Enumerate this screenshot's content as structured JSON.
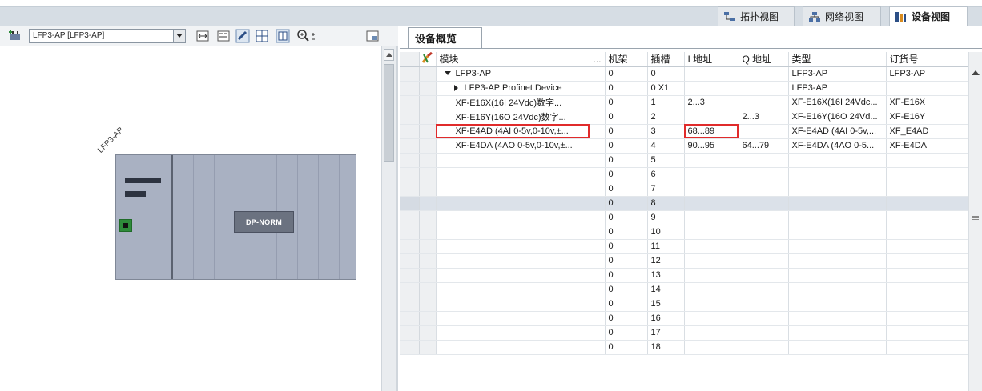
{
  "view_tabs": [
    {
      "label": "拓扑视图",
      "icon": "topology-view-icon",
      "active": false
    },
    {
      "label": "网络视图",
      "icon": "network-view-icon",
      "active": false
    },
    {
      "label": "设备视图",
      "icon": "device-view-icon",
      "active": true
    }
  ],
  "device_selector": {
    "value": "LFP3-AP [LFP3-AP]"
  },
  "canvas": {
    "rack_label": "LFP3-AP",
    "module_label": "DP-NORM"
  },
  "overview": {
    "tab_label": "设备概览",
    "columns": {
      "module": "模块",
      "more": "...",
      "rack": "机架",
      "slot": "插槽",
      "i_addr": "I 地址",
      "q_addr": "Q 地址",
      "type": "类型",
      "order": "订货号"
    },
    "rows": [
      {
        "module": "LFP3-AP",
        "rack": "0",
        "slot": "0",
        "i_addr": "",
        "q_addr": "",
        "type": "LFP3-AP",
        "order": "LFP3-AP",
        "indent": "expanded"
      },
      {
        "module": "LFP3-AP Profinet Device",
        "rack": "0",
        "slot": "0 X1",
        "i_addr": "",
        "q_addr": "",
        "type": "LFP3-AP",
        "order": "",
        "indent": "collapsed"
      },
      {
        "module": "XF-E16X(16I 24Vdc)数字...",
        "rack": "0",
        "slot": "1",
        "i_addr": "2...3",
        "q_addr": "",
        "type": "XF-E16X(16I 24Vdc...",
        "order": "XF-E16X",
        "indent": "leaf"
      },
      {
        "module": "XF-E16Y(16O 24Vdc)数字...",
        "rack": "0",
        "slot": "2",
        "i_addr": "",
        "q_addr": "2...3",
        "type": "XF-E16Y(16O 24Vd...",
        "order": "XF-E16Y",
        "indent": "leaf"
      },
      {
        "module": "XF-E4AD (4AI 0-5v,0-10v,±...",
        "rack": "0",
        "slot": "3",
        "i_addr": "68...89",
        "q_addr": "",
        "type": "XF-E4AD (4AI 0-5v,...",
        "order": "XF_E4AD",
        "indent": "leaf",
        "highlight": true
      },
      {
        "module": "XF-E4DA (4AO 0-5v,0-10v,±...",
        "rack": "0",
        "slot": "4",
        "i_addr": "90...95",
        "q_addr": "64...79",
        "type": "XF-E4DA (4AO 0-5...",
        "order": "XF-E4DA",
        "indent": "leaf"
      },
      {
        "module": "",
        "rack": "0",
        "slot": "5",
        "i_addr": "",
        "q_addr": "",
        "type": "",
        "order": "",
        "indent": "leaf"
      },
      {
        "module": "",
        "rack": "0",
        "slot": "6",
        "i_addr": "",
        "q_addr": "",
        "type": "",
        "order": "",
        "indent": "leaf"
      },
      {
        "module": "",
        "rack": "0",
        "slot": "7",
        "i_addr": "",
        "q_addr": "",
        "type": "",
        "order": "",
        "indent": "leaf"
      },
      {
        "module": "",
        "rack": "0",
        "slot": "8",
        "i_addr": "",
        "q_addr": "",
        "type": "",
        "order": "",
        "indent": "leaf",
        "selected": true
      },
      {
        "module": "",
        "rack": "0",
        "slot": "9",
        "i_addr": "",
        "q_addr": "",
        "type": "",
        "order": "",
        "indent": "leaf"
      },
      {
        "module": "",
        "rack": "0",
        "slot": "10",
        "i_addr": "",
        "q_addr": "",
        "type": "",
        "order": "",
        "indent": "leaf"
      },
      {
        "module": "",
        "rack": "0",
        "slot": "11",
        "i_addr": "",
        "q_addr": "",
        "type": "",
        "order": "",
        "indent": "leaf"
      },
      {
        "module": "",
        "rack": "0",
        "slot": "12",
        "i_addr": "",
        "q_addr": "",
        "type": "",
        "order": "",
        "indent": "leaf"
      },
      {
        "module": "",
        "rack": "0",
        "slot": "13",
        "i_addr": "",
        "q_addr": "",
        "type": "",
        "order": "",
        "indent": "leaf"
      },
      {
        "module": "",
        "rack": "0",
        "slot": "14",
        "i_addr": "",
        "q_addr": "",
        "type": "",
        "order": "",
        "indent": "leaf"
      },
      {
        "module": "",
        "rack": "0",
        "slot": "15",
        "i_addr": "",
        "q_addr": "",
        "type": "",
        "order": "",
        "indent": "leaf"
      },
      {
        "module": "",
        "rack": "0",
        "slot": "16",
        "i_addr": "",
        "q_addr": "",
        "type": "",
        "order": "",
        "indent": "leaf"
      },
      {
        "module": "",
        "rack": "0",
        "slot": "17",
        "i_addr": "",
        "q_addr": "",
        "type": "",
        "order": "",
        "indent": "leaf"
      },
      {
        "module": "",
        "rack": "0",
        "slot": "18",
        "i_addr": "",
        "q_addr": "",
        "type": "",
        "order": "",
        "indent": "leaf"
      }
    ]
  },
  "colors": {
    "highlight_box": "#e02b2b",
    "rack_fill": "#a9b1c2",
    "port_green": "#2e8b3a"
  }
}
